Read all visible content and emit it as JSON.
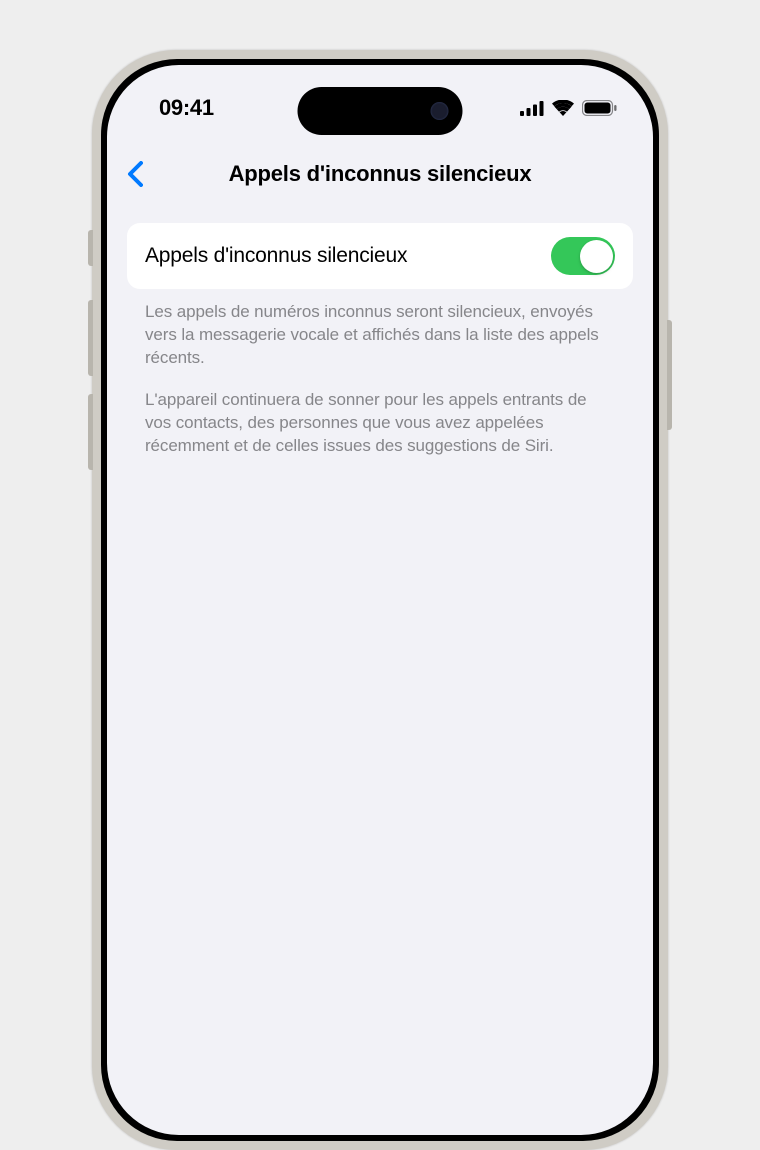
{
  "status": {
    "time": "09:41"
  },
  "nav": {
    "title": "Appels d'inconnus silencieux"
  },
  "setting": {
    "label": "Appels d'inconnus silencieux",
    "toggle_on": true
  },
  "footer": {
    "p1": "Les appels de numéros inconnus seront silencieux, envoyés vers la messagerie vocale et affichés dans la liste des appels récents.",
    "p2": "L'appareil continuera de sonner pour les appels entrants de vos contacts, des personnes que vous avez appelées récemment et de celles issues des suggestions de Siri."
  },
  "colors": {
    "toggle_on": "#34c759",
    "accent_blue": "#007aff",
    "screen_bg": "#f2f2f7",
    "footer_text": "#86868a"
  }
}
